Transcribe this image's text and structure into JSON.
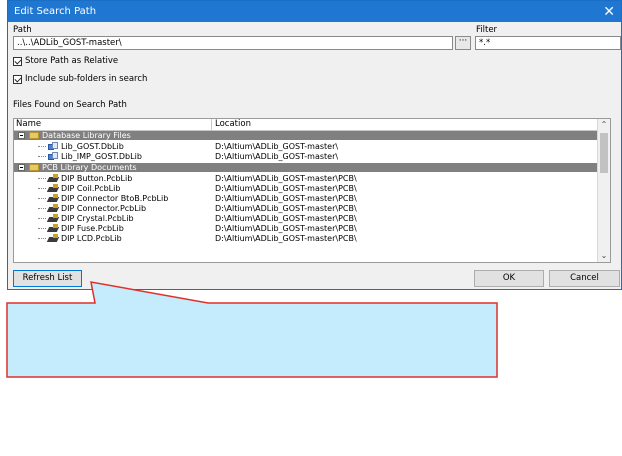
{
  "dialog": {
    "title": "Edit Search Path",
    "close_glyph": "✕"
  },
  "path": {
    "label": "Path",
    "value": "..\\..\\ADLib_GOST-master\\",
    "browse_label": "···"
  },
  "filter": {
    "label": "Filter",
    "value": "*.*"
  },
  "options": {
    "store_relative": "Store Path as Relative",
    "include_subfolders": "Include sub-folders in search"
  },
  "files_found_label": "Files Found on Search Path",
  "table": {
    "col_name": "Name",
    "col_location": "Location",
    "groups": [
      {
        "name": "Database Library Files",
        "items": [
          {
            "name": "Lib_GOST.DbLib",
            "location": "D:\\Altium\\ADLib_GOST-master\\",
            "icon": "dblib-icon"
          },
          {
            "name": "Lib_IMP_GOST.DbLib",
            "location": "D:\\Altium\\ADLib_GOST-master\\",
            "icon": "dblib-icon"
          }
        ]
      },
      {
        "name": "PCB Library Documents",
        "items": [
          {
            "name": "DIP Button.PcbLib",
            "location": "D:\\Altium\\ADLib_GOST-master\\PCB\\",
            "icon": "pcblib-icon"
          },
          {
            "name": "DIP Coil.PcbLib",
            "location": "D:\\Altium\\ADLib_GOST-master\\PCB\\",
            "icon": "pcblib-icon"
          },
          {
            "name": "DIP Connector BtoB.PcbLib",
            "location": "D:\\Altium\\ADLib_GOST-master\\PCB\\",
            "icon": "pcblib-icon"
          },
          {
            "name": "DIP Connector.PcbLib",
            "location": "D:\\Altium\\ADLib_GOST-master\\PCB\\",
            "icon": "pcblib-icon"
          },
          {
            "name": "DIP Crystal.PcbLib",
            "location": "D:\\Altium\\ADLib_GOST-master\\PCB\\",
            "icon": "pcblib-icon"
          },
          {
            "name": "DIP Fuse.PcbLib",
            "location": "D:\\Altium\\ADLib_GOST-master\\PCB\\",
            "icon": "pcblib-icon"
          },
          {
            "name": "DIP LCD.PcbLib",
            "location": "D:\\Altium\\ADLib_GOST-master\\PCB\\",
            "icon": "pcblib-icon"
          }
        ]
      }
    ]
  },
  "buttons": {
    "refresh": "Refresh List",
    "ok": "OK",
    "cancel": "Cancel"
  },
  "colors": {
    "title_bar": "#1f77d2",
    "group_row": "#808080",
    "callout_fill": "#c5ecfc",
    "callout_border": "#e0302a"
  }
}
